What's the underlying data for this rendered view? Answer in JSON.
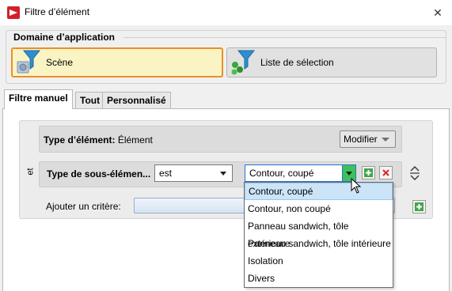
{
  "window": {
    "title": "Filtre d’élément",
    "close_glyph": "✕"
  },
  "domain_group": {
    "label": "Domaine d’application",
    "buttons": [
      {
        "label": "Scène",
        "icon": "funnel-scene-icon",
        "selected": true
      },
      {
        "label": "Liste de sélection",
        "icon": "funnel-list-icon",
        "selected": false
      }
    ]
  },
  "tabs": [
    {
      "label": "Filtre manuel",
      "active": true
    },
    {
      "label": "Tout",
      "active": false
    },
    {
      "label": "Personnalisé",
      "active": false
    }
  ],
  "criteria": {
    "element_type": {
      "label": "Type d’élément:",
      "value": "Élément",
      "modify_label": "Modifier"
    },
    "connector": "et",
    "sub_type": {
      "label": "Type de sous-élémen...",
      "operator": "est",
      "value": "Contour, coupé"
    },
    "add_criterion_label": "Ajouter un critère:"
  },
  "dropdown": {
    "options": [
      {
        "label": "Contour, coupé",
        "highlighted": true
      },
      {
        "label": "Contour, non coupé",
        "highlighted": false
      },
      {
        "label": "Panneau sandwich, tôle extérieure",
        "highlighted": false
      },
      {
        "label": "Panneau sandwich, tôle intérieure",
        "highlighted": false
      },
      {
        "label": "Isolation",
        "highlighted": false
      },
      {
        "label": "Divers",
        "highlighted": false
      }
    ]
  },
  "colors": {
    "accent_orange": "#e8902a",
    "selected_bg": "#faf3c4",
    "add_green": "#3fc15a",
    "delete_red": "#d9262c",
    "highlight": "#cce4f7"
  }
}
